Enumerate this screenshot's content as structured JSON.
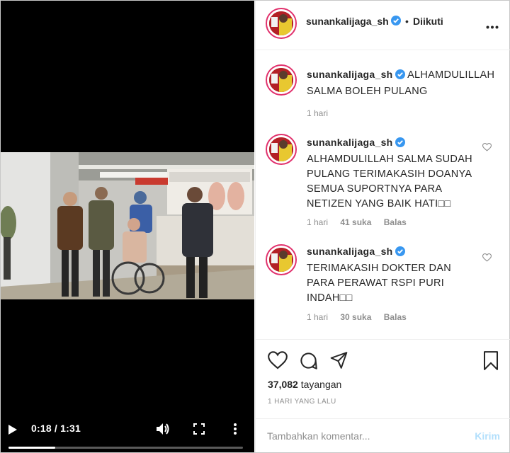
{
  "video": {
    "time_current": "0:18",
    "time_total": "1:31",
    "time_sep": " / ",
    "progress": 0.2,
    "icons": {
      "play": "play-icon",
      "volume": "volume-icon",
      "fullscreen": "fullscreen-icon",
      "more": "more-vertical-icon"
    }
  },
  "header": {
    "username": "sunankalijaga_sh",
    "dot": "•",
    "follow_status": "Diikuti",
    "more_icon": "more-horizontal-icon"
  },
  "comments": [
    {
      "username": "sunankalijaga_sh",
      "text_lines": [
        "ALHAMDULILLAH",
        "SALMA BOLEH PULANG"
      ],
      "time": "1 hari",
      "likes": "",
      "reply": ""
    },
    {
      "username": "sunankalijaga_sh",
      "text_lines": [
        "ALHAMDULILLAH SALMA SUDAH",
        "PULANG TERIMAKASIH DOANYA",
        "SEMUA SUPORTNYA PARA",
        "NETIZEN YANG BAIK HATI□□"
      ],
      "time": "1 hari",
      "likes": "41 suka",
      "reply": "Balas"
    },
    {
      "username": "sunankalijaga_sh",
      "text_lines": [
        "TERIMAKASIH DOKTER DAN",
        "PARA PERAWAT RSPI PURI",
        "INDAH□□"
      ],
      "time": "1 hari",
      "likes": "30 suka",
      "reply": "Balas"
    }
  ],
  "actions": {
    "views_count": "37,082",
    "views_label": "tayangan",
    "posted_ago": "1 HARI YANG LALU",
    "icons": [
      "heart-icon",
      "comment-icon",
      "share-icon",
      "bookmark-icon"
    ]
  },
  "add_comment": {
    "placeholder": "Tambahkan komentar...",
    "post_label": "Kirim"
  },
  "colors": {
    "verified": "#3897f0",
    "post_disabled": "#b2dffc",
    "avatar_ring": "#e1306c",
    "muted": "#8e8e8e"
  }
}
